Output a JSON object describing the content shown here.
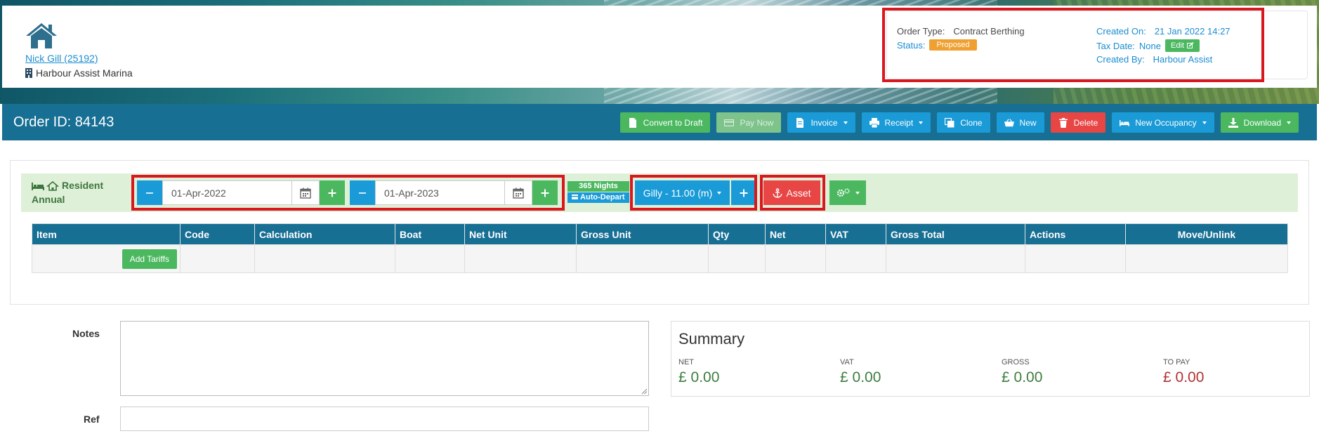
{
  "header": {
    "user_link": "Nick Gill (25192)",
    "marina": "Harbour Assist Marina"
  },
  "info": {
    "order_type_label": "Order Type:",
    "order_type": "Contract Berthing",
    "status_label": "Status:",
    "status": "Proposed",
    "created_on_label": "Created On:",
    "created_on": "21 Jan 2022 14:27",
    "tax_date_label": "Tax Date:",
    "tax_date": "None",
    "edit_label": "Edit",
    "created_by_label": "Created By:",
    "created_by": "Harbour Assist"
  },
  "order": {
    "title": "Order ID: 84143",
    "toolbar": [
      {
        "label": "Convert to Draft",
        "color": "#4bb860",
        "icon": "document-icon"
      },
      {
        "label": "Pay Now",
        "color": "#7dc38a",
        "icon": "card-icon"
      },
      {
        "label": "Invoice",
        "color": "#1a9bd7",
        "icon": "invoice-icon",
        "dropdown": true
      },
      {
        "label": "Receipt",
        "color": "#1a9bd7",
        "icon": "printer-icon",
        "dropdown": true
      },
      {
        "label": "Clone",
        "color": "#1a9bd7",
        "icon": "copy-icon"
      },
      {
        "label": "New",
        "color": "#1a9bd7",
        "icon": "basket-icon"
      },
      {
        "label": "Delete",
        "color": "#e84545",
        "icon": "trash-icon"
      },
      {
        "label": "New Occupancy",
        "color": "#1a9bd7",
        "icon": "bed-icon",
        "dropdown": true
      },
      {
        "label": "Download",
        "color": "#4bb860",
        "icon": "download-icon",
        "dropdown": true
      }
    ]
  },
  "occupancy": {
    "label_line1": "Resident",
    "label_line2": "Annual",
    "start_date": "01-Apr-2022",
    "end_date": "01-Apr-2023",
    "nights": "365 Nights",
    "auto_depart": "Auto-Depart",
    "boat": "Gilly - 11.00 (m)",
    "asset": "Asset"
  },
  "table": {
    "columns": [
      "Item",
      "Code",
      "Calculation",
      "Boat",
      "Net Unit",
      "Gross Unit",
      "Qty",
      "Net",
      "VAT",
      "Gross Total",
      "Actions",
      "Move/Unlink"
    ],
    "add_tariffs": "Add Tariffs"
  },
  "form": {
    "notes_label": "Notes",
    "ref_label": "Ref"
  },
  "summary": {
    "title": "Summary",
    "net_label": "NET",
    "net": "£ 0.00",
    "vat_label": "VAT",
    "vat": "£ 0.00",
    "gross_label": "GROSS",
    "gross": "£ 0.00",
    "topay_label": "TO PAY",
    "topay": "£ 0.00"
  }
}
